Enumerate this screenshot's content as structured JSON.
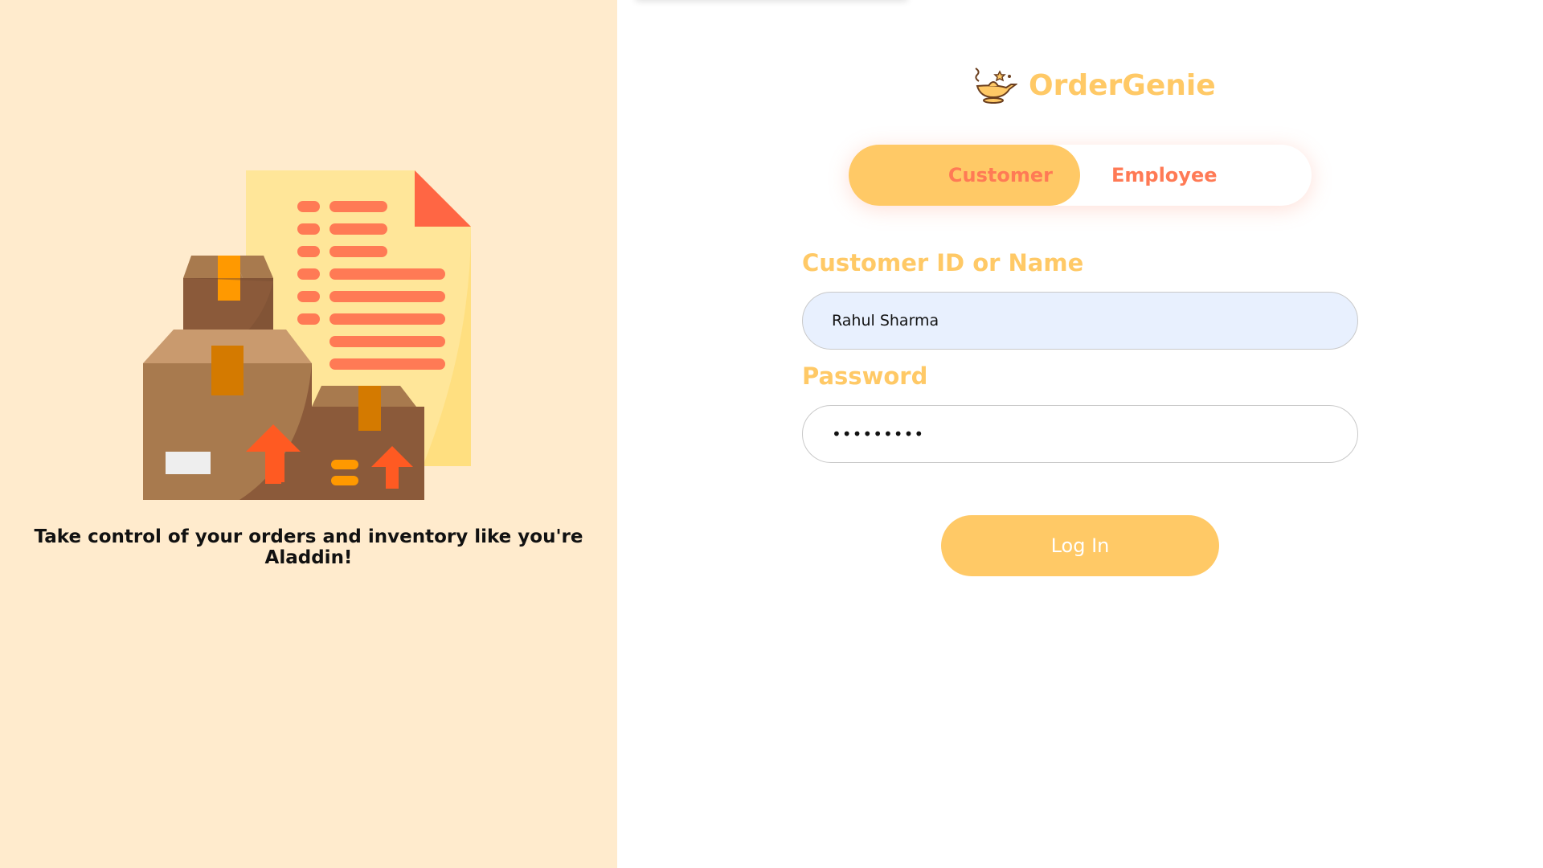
{
  "app": {
    "name": "OrderGenie",
    "tagline": "Take control of your orders and inventory like you're Aladdin!",
    "brand_icon": "genie-lamp-icon",
    "illustration": "boxes-and-document-illustration"
  },
  "login": {
    "role_tabs": [
      {
        "label": "Customer",
        "active": true
      },
      {
        "label": "Employee",
        "active": false
      }
    ],
    "id_field": {
      "label": "Customer ID or Name",
      "value": "Rahul Sharma"
    },
    "password_field": {
      "label": "Password",
      "value": "•••••••••"
    },
    "submit_label": "Log In"
  },
  "colors": {
    "left_background": "#ffebcd",
    "accent": "#ffc966",
    "tab_text": "#ff7a55",
    "autofill_background": "#e8f0fe"
  }
}
